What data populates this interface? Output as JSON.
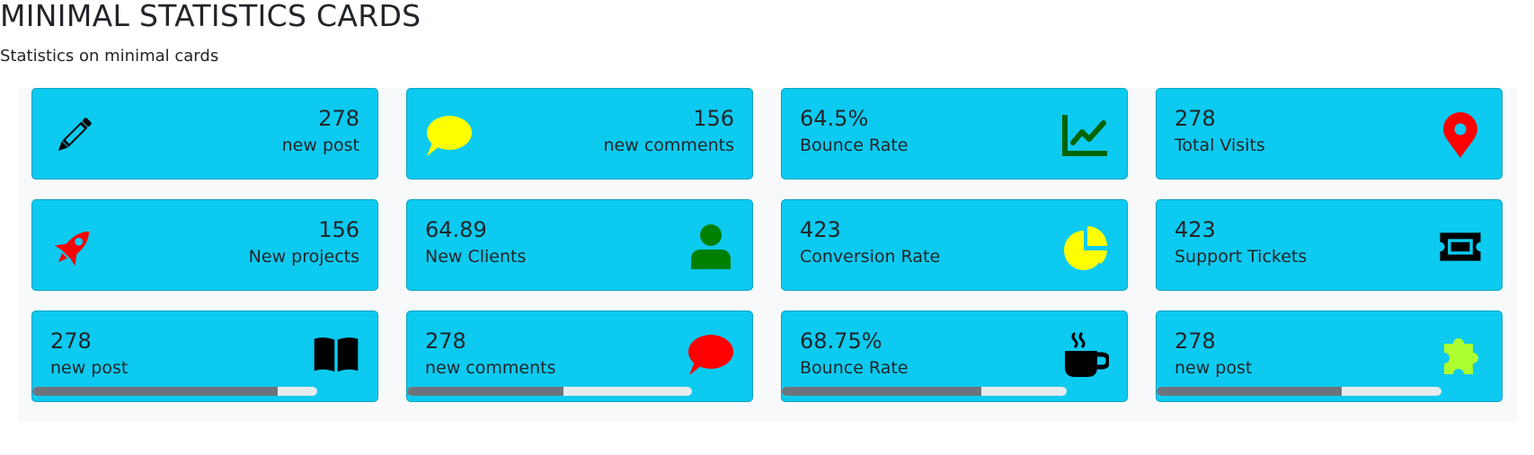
{
  "page": {
    "title": "MINIMAL STATISTICS CARDS",
    "subtitle": "Statistics on minimal cards"
  },
  "colors": {
    "card_bg": "#0dcaf0",
    "progress_fill": "#6c757d",
    "progress_track": "#e9ecef"
  },
  "cards": [
    {
      "value": "278",
      "label": "new post",
      "icon": "pencil-icon",
      "icon_color": "#000000"
    },
    {
      "value": "156",
      "label": "new comments",
      "icon": "comment-icon",
      "icon_color": "#ffff00"
    },
    {
      "value": "64.5%",
      "label": "Bounce Rate",
      "icon": "chart-line-icon",
      "icon_color": "#006400"
    },
    {
      "value": "278",
      "label": "Total Visits",
      "icon": "map-marker-icon",
      "icon_color": "#ff0000"
    },
    {
      "value": "156",
      "label": "New projects",
      "icon": "rocket-icon",
      "icon_color": "#ff0000"
    },
    {
      "value": "64.89",
      "label": "New Clients",
      "icon": "user-icon",
      "icon_color": "#008000"
    },
    {
      "value": "423",
      "label": "Conversion Rate",
      "icon": "pie-chart-icon",
      "icon_color": "#ffff00"
    },
    {
      "value": "423",
      "label": "Support Tickets",
      "icon": "ticket-icon",
      "icon_color": "#000000"
    },
    {
      "value": "278",
      "label": "new post",
      "icon": "book-icon",
      "icon_color": "#000000",
      "progress": 0.86
    },
    {
      "value": "278",
      "label": "new comments",
      "icon": "comment-icon",
      "icon_color": "#ff0000",
      "progress": 0.55
    },
    {
      "value": "68.75%",
      "label": "Bounce Rate",
      "icon": "coffee-icon",
      "icon_color": "#000000",
      "progress": 0.7
    },
    {
      "value": "278",
      "label": "new post",
      "icon": "puzzle-icon",
      "icon_color": "#adff2f",
      "progress": 0.65
    }
  ]
}
